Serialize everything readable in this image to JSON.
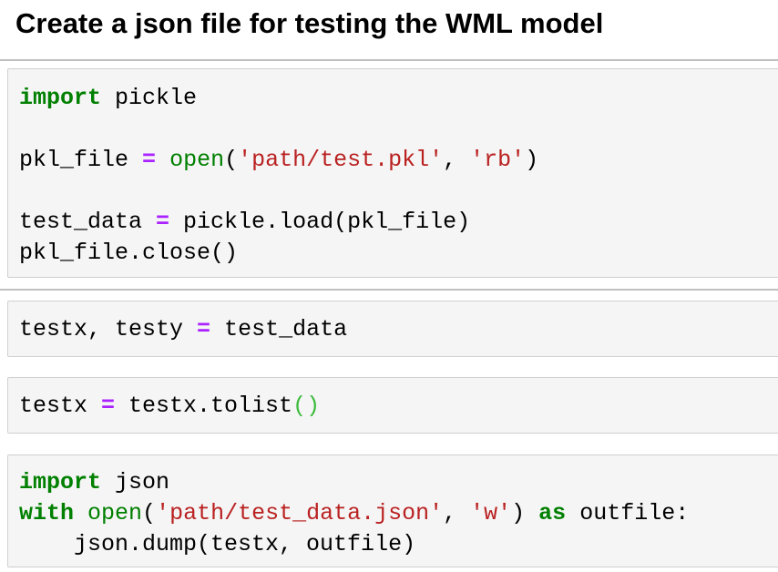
{
  "heading": "Create a json file for testing the WML model",
  "cells": [
    {
      "lines": [
        [
          {
            "t": "import",
            "c": "kw"
          },
          {
            "t": " pickle",
            "c": "pn"
          }
        ],
        [],
        [
          {
            "t": "pkl_file ",
            "c": "pn"
          },
          {
            "t": "=",
            "c": "op"
          },
          {
            "t": " ",
            "c": "pn"
          },
          {
            "t": "open",
            "c": "bi"
          },
          {
            "t": "(",
            "c": "pn"
          },
          {
            "t": "'path/test.pkl'",
            "c": "st"
          },
          {
            "t": ", ",
            "c": "pn"
          },
          {
            "t": "'rb'",
            "c": "st"
          },
          {
            "t": ")",
            "c": "pn"
          }
        ],
        [],
        [
          {
            "t": "test_data ",
            "c": "pn"
          },
          {
            "t": "=",
            "c": "op"
          },
          {
            "t": " pickle.load(pkl_file)",
            "c": "pn"
          }
        ],
        [
          {
            "t": "pkl_file.close()",
            "c": "pn"
          }
        ]
      ]
    },
    {
      "lines": [
        [
          {
            "t": "testx, testy ",
            "c": "pn"
          },
          {
            "t": "=",
            "c": "op"
          },
          {
            "t": " test_data",
            "c": "pn"
          }
        ]
      ]
    },
    {
      "lines": [
        [
          {
            "t": "testx ",
            "c": "pn"
          },
          {
            "t": "=",
            "c": "op"
          },
          {
            "t": " testx.tolist",
            "c": "pn"
          },
          {
            "t": "()",
            "c": "br"
          }
        ]
      ]
    },
    {
      "lines": [
        [
          {
            "t": "import",
            "c": "kw"
          },
          {
            "t": " json",
            "c": "pn"
          }
        ],
        [
          {
            "t": "with",
            "c": "kw"
          },
          {
            "t": " ",
            "c": "pn"
          },
          {
            "t": "open",
            "c": "bi"
          },
          {
            "t": "(",
            "c": "pn"
          },
          {
            "t": "'path/test_data.json'",
            "c": "st"
          },
          {
            "t": ", ",
            "c": "pn"
          },
          {
            "t": "'w'",
            "c": "st"
          },
          {
            "t": ") ",
            "c": "pn"
          },
          {
            "t": "as",
            "c": "kw"
          },
          {
            "t": " outfile:",
            "c": "pn"
          }
        ],
        [
          {
            "t": "    json.dump(testx, outfile)",
            "c": "pn"
          }
        ]
      ]
    }
  ]
}
